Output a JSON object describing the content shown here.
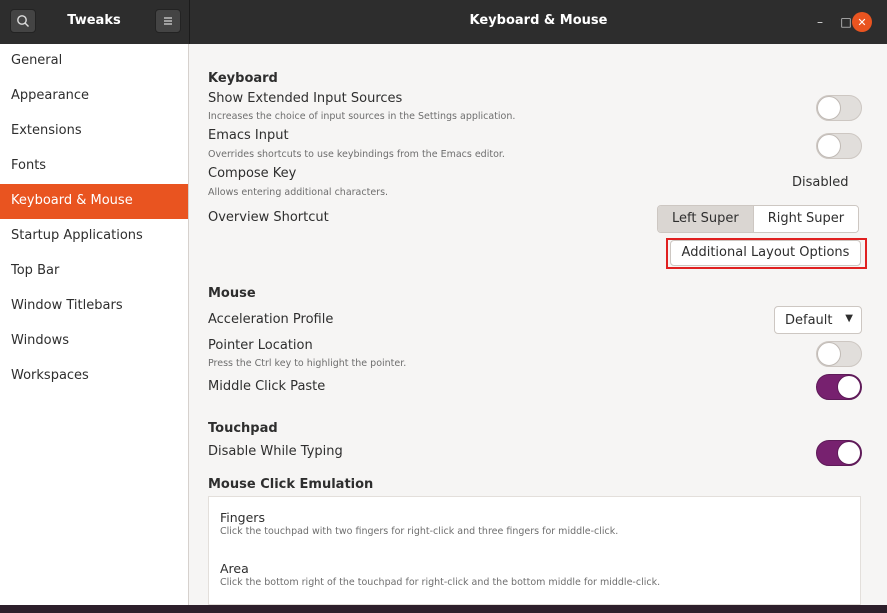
{
  "header": {
    "sidebar_title": "Tweaks",
    "main_title": "Keyboard & Mouse",
    "search_icon": "search-icon",
    "menu_icon": "hamburger-menu-icon",
    "minimize_glyph": "–",
    "maximize_glyph": "□",
    "close_glyph": "✕"
  },
  "sidebar": {
    "items": [
      {
        "label": "General"
      },
      {
        "label": "Appearance"
      },
      {
        "label": "Extensions"
      },
      {
        "label": "Fonts"
      },
      {
        "label": "Keyboard & Mouse",
        "active": true
      },
      {
        "label": "Startup Applications"
      },
      {
        "label": "Top Bar"
      },
      {
        "label": "Window Titlebars"
      },
      {
        "label": "Windows"
      },
      {
        "label": "Workspaces"
      }
    ]
  },
  "keyboard": {
    "title": "Keyboard",
    "extended_sources": {
      "label": "Show Extended Input Sources",
      "desc": "Increases the choice of input sources in the Settings application.",
      "enabled": false
    },
    "emacs_input": {
      "label": "Emacs Input",
      "desc": "Overrides shortcuts to use keybindings from the Emacs editor.",
      "enabled": false
    },
    "compose_key": {
      "label": "Compose Key",
      "desc": "Allows entering additional characters.",
      "value": "Disabled"
    },
    "overview_shortcut": {
      "label": "Overview Shortcut",
      "options": [
        "Left Super",
        "Right Super"
      ],
      "selected": "Left Super"
    },
    "additional_layout_button": "Additional Layout Options"
  },
  "mouse": {
    "title": "Mouse",
    "acceleration_profile": {
      "label": "Acceleration Profile",
      "value": "Default"
    },
    "pointer_location": {
      "label": "Pointer Location",
      "desc": "Press the Ctrl key to highlight the pointer.",
      "enabled": false
    },
    "middle_click_paste": {
      "label": "Middle Click Paste",
      "enabled": true
    }
  },
  "touchpad": {
    "title": "Touchpad",
    "disable_while_typing": {
      "label": "Disable While Typing",
      "enabled": true
    }
  },
  "click_emulation": {
    "title": "Mouse Click Emulation",
    "options": [
      {
        "title": "Fingers",
        "desc": "Click the touchpad with two fingers for right-click and three fingers for middle-click."
      },
      {
        "title": "Area",
        "desc": "Click the bottom right of the touchpad for right-click and the bottom middle for middle-click."
      }
    ]
  },
  "colors": {
    "accent": "#e95420",
    "toggle_on": "#77216f",
    "header": "#2d2d2d"
  }
}
